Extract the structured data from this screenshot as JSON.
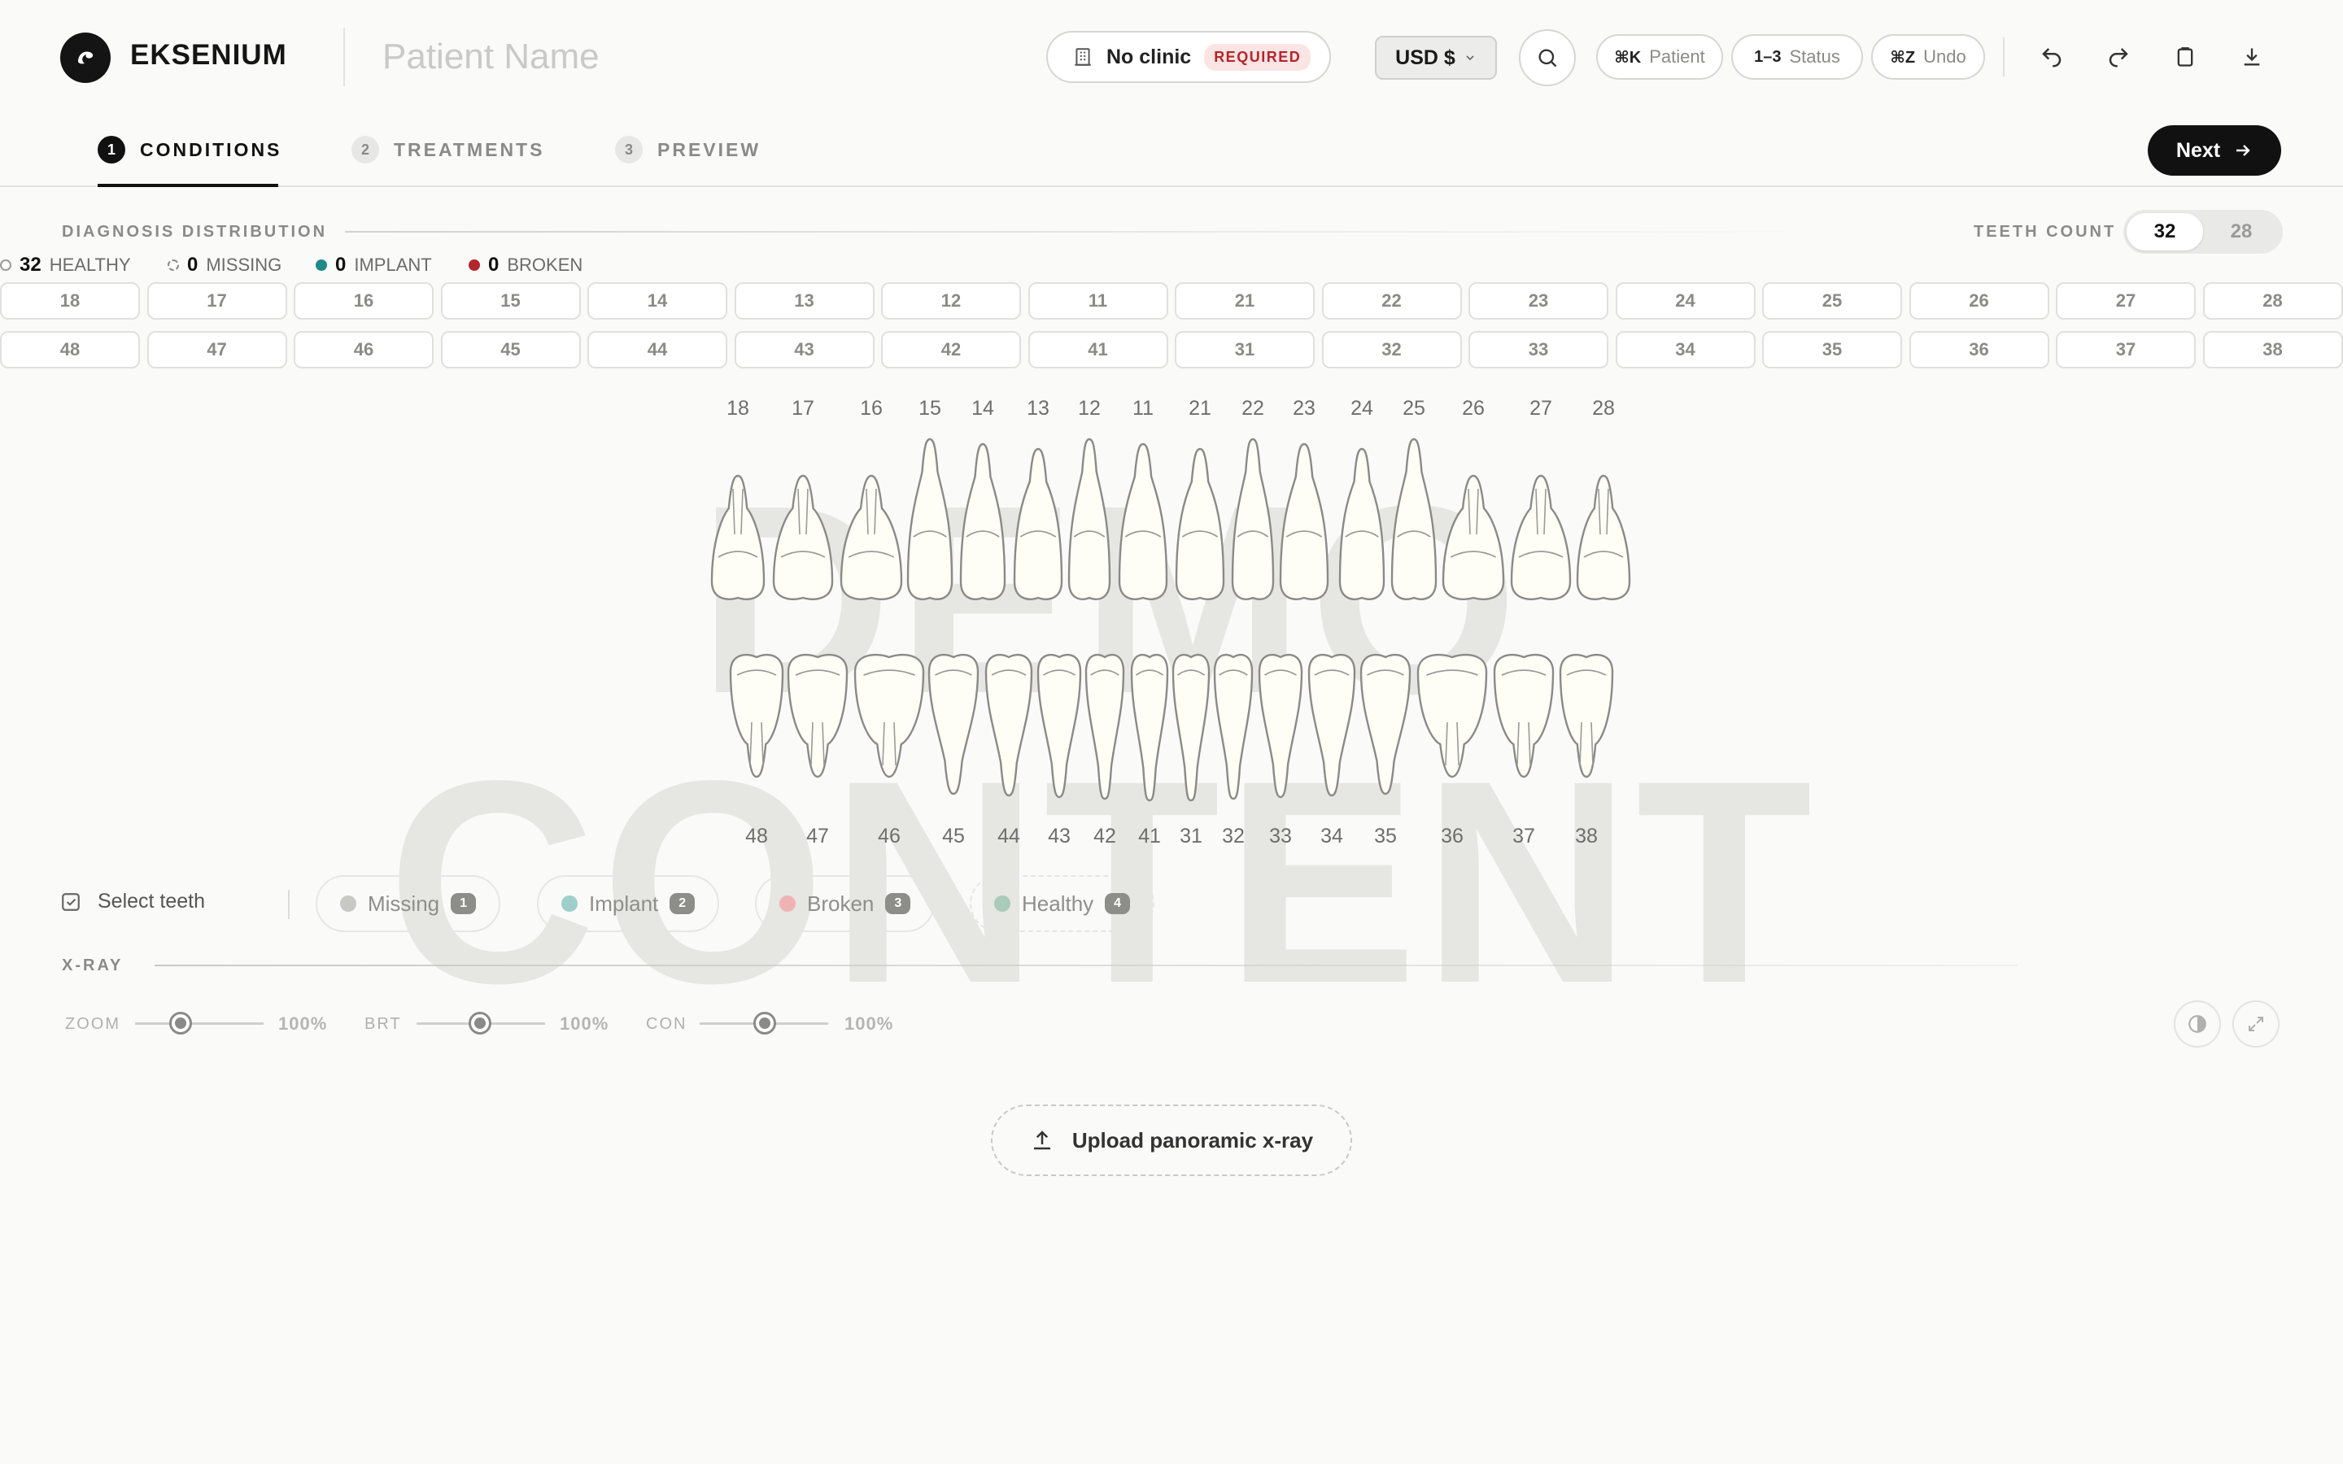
{
  "header": {
    "brand": "EKSENIUM",
    "patient_placeholder": "Patient Name",
    "clinic": "No clinic",
    "clinic_badge": "REQUIRED",
    "currency": "USD $",
    "shortcuts": [
      {
        "key": "⌘K",
        "label": "Patient"
      },
      {
        "key": "1–3",
        "label": "Status"
      },
      {
        "key": "⌘Z",
        "label": "Undo"
      }
    ]
  },
  "tabs": [
    {
      "num": "1",
      "label": "CONDITIONS",
      "active": true
    },
    {
      "num": "2",
      "label": "TREATMENTS",
      "active": false
    },
    {
      "num": "3",
      "label": "PREVIEW",
      "active": false
    }
  ],
  "next_label": "Next",
  "diagnosis": {
    "title": "DIAGNOSIS DISTRIBUTION",
    "teeth_count_label": "TEETH COUNT",
    "teeth_count_options": [
      "32",
      "28"
    ],
    "teeth_count_selected": "32",
    "legend": [
      {
        "count": "32",
        "label": "HEALTHY",
        "color": "#ffffff"
      },
      {
        "count": "0",
        "label": "MISSING",
        "color": "#ffffff"
      },
      {
        "count": "0",
        "label": "IMPLANT",
        "color": "#1f8a8a"
      },
      {
        "count": "0",
        "label": "BROKEN",
        "color": "#b3262b"
      }
    ]
  },
  "grid": {
    "upper": [
      "18",
      "17",
      "16",
      "15",
      "14",
      "13",
      "12",
      "11",
      "21",
      "22",
      "23",
      "24",
      "25",
      "26",
      "27",
      "28"
    ],
    "lower": [
      "48",
      "47",
      "46",
      "45",
      "44",
      "43",
      "42",
      "41",
      "31",
      "32",
      "33",
      "34",
      "35",
      "36",
      "37",
      "38"
    ]
  },
  "chart": {
    "upper_numbers": [
      "18",
      "17",
      "16",
      "15",
      "14",
      "13",
      "12",
      "11",
      "21",
      "22",
      "23",
      "24",
      "25",
      "26",
      "27",
      "28"
    ],
    "lower_numbers": [
      "48",
      "47",
      "46",
      "45",
      "44",
      "43",
      "42",
      "41",
      "31",
      "32",
      "33",
      "34",
      "35",
      "36",
      "37",
      "38"
    ]
  },
  "watermark": [
    "DEMO",
    "CONTENT"
  ],
  "select_teeth_label": "Select teeth",
  "filters": [
    {
      "label": "Missing",
      "badge": "1",
      "color": "#c8c8c5"
    },
    {
      "label": "Implant",
      "badge": "2",
      "color": "#9ecfcb"
    },
    {
      "label": "Broken",
      "badge": "3",
      "color": "#f0b3b3"
    },
    {
      "label": "Healthy",
      "badge": "4",
      "color": "#a9cbb7"
    }
  ],
  "xray": {
    "title": "X-RAY",
    "sliders": [
      {
        "label": "ZOOM",
        "value": "100%"
      },
      {
        "label": "BRT",
        "value": "100%"
      },
      {
        "label": "CON",
        "value": "100%"
      }
    ],
    "upload_label": "Upload panoramic x-ray"
  }
}
